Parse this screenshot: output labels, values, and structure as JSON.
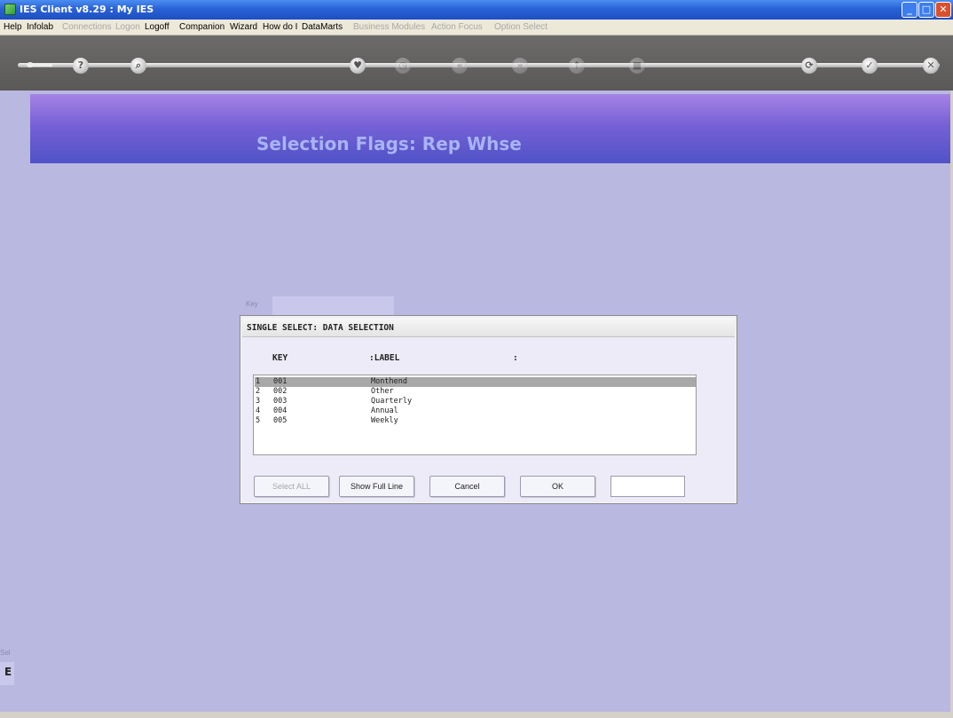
{
  "window": {
    "title": "IES Client v8.29 : My IES"
  },
  "menu": [
    {
      "label": "Help",
      "enabled": true
    },
    {
      "label": "Infolab",
      "enabled": true
    },
    {
      "label": "Connections",
      "enabled": false
    },
    {
      "label": "Logon",
      "enabled": false
    },
    {
      "label": "Logoff",
      "enabled": true
    },
    {
      "label": "Companion",
      "enabled": true
    },
    {
      "label": "Wizard",
      "enabled": true
    },
    {
      "label": "How do I",
      "enabled": true
    },
    {
      "label": "DataMarts",
      "enabled": true
    },
    {
      "label": "Business Modules",
      "enabled": false
    },
    {
      "label": "Action Focus",
      "enabled": false
    },
    {
      "label": "Option Select",
      "enabled": false
    }
  ],
  "toolbar": {
    "icons": [
      "key-icon",
      "help-icon",
      "search-icon",
      "heart-icon",
      "clock-icon",
      "rewind-icon",
      "fast-forward-icon",
      "upload-icon",
      "stop-icon",
      "refresh-icon",
      "check-icon",
      "close-icon"
    ],
    "glyphs": {
      "help": "?",
      "search": "⌕",
      "heart": "♥",
      "clock": "◷",
      "rewind": "«",
      "forward": "»",
      "upload": "⇡",
      "stop": "■",
      "refresh": "⟳",
      "check": "✓",
      "close": "✕"
    }
  },
  "page": {
    "title": "Selection Flags: Rep Whse"
  },
  "key_field": {
    "label": "Key",
    "value": ""
  },
  "dialog": {
    "title": "SINGLE SELECT: DATA SELECTION",
    "columns": {
      "key": "KEY",
      "label": ":LABEL",
      "extra": ":"
    },
    "rows": [
      {
        "num": "1",
        "key": "001",
        "label": "Monthend",
        "selected": true
      },
      {
        "num": "2",
        "key": "002",
        "label": "Other",
        "selected": false
      },
      {
        "num": "3",
        "key": "003",
        "label": "Quarterly",
        "selected": false
      },
      {
        "num": "4",
        "key": "004",
        "label": "Annual",
        "selected": false
      },
      {
        "num": "5",
        "key": "005",
        "label": "Weekly",
        "selected": false
      }
    ],
    "buttons": {
      "select_all": "Select ALL",
      "show_full_line": "Show Full Line",
      "cancel": "Cancel",
      "ok": "OK"
    },
    "search_value": ""
  },
  "footer": {
    "sel_label": "Sel",
    "stub_letter": "E"
  },
  "colors": {
    "titlebar": "#2a62d6",
    "workspace": "#b9b8e0",
    "banner": "#7661d6",
    "banner_title": "#a9b3f2",
    "selected_row": "#a8a8a8"
  }
}
